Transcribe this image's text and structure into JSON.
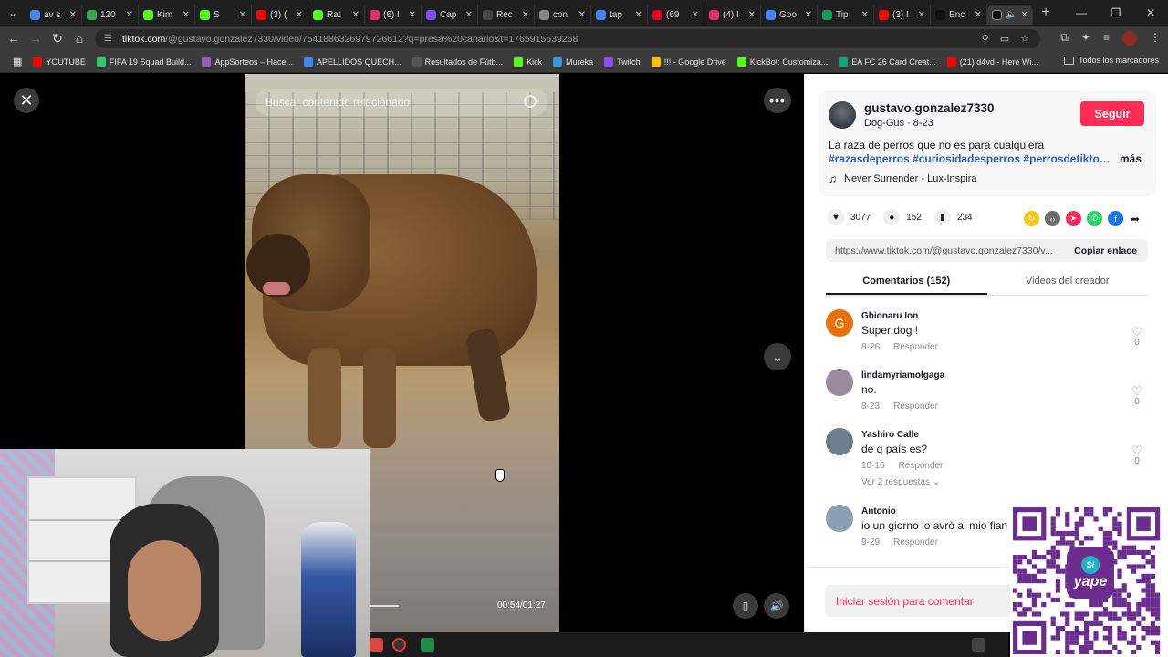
{
  "browser": {
    "tabs": [
      {
        "label": "av s",
        "color": "#4285f4"
      },
      {
        "label": "120",
        "color": "#34a853"
      },
      {
        "label": "Kim",
        "color": "#53fc18"
      },
      {
        "label": "S",
        "color": "#53fc18"
      },
      {
        "label": "(3) (",
        "color": "#ff0000"
      },
      {
        "label": "Rat",
        "color": "#53fc18"
      },
      {
        "label": "(6) I",
        "color": "#e1306c"
      },
      {
        "label": "Cap",
        "color": "#7c4dff"
      },
      {
        "label": "Rec",
        "color": "#444444"
      },
      {
        "label": "con",
        "color": "#888888"
      },
      {
        "label": "tap",
        "color": "#4285f4"
      },
      {
        "label": "(69",
        "color": "#e60023"
      },
      {
        "label": "(4) I",
        "color": "#e1306c"
      },
      {
        "label": "Goo",
        "color": "#4285f4"
      },
      {
        "label": "Tip",
        "color": "#0f9d58"
      },
      {
        "label": "(3) I",
        "color": "#ff0000"
      },
      {
        "label": "Enc",
        "color": "#111111"
      }
    ],
    "url_host": "tiktok.com",
    "url_path": "/@gustavo.gonzalez7330/video/7541886326979726612?q=presa%20canario&t=1765915539268",
    "bookmarks": [
      {
        "label": "YOUTUBE",
        "color": "#ff0000"
      },
      {
        "label": "FIFA 19 Squad Build...",
        "color": "#2ecc71"
      },
      {
        "label": "AppSorteos – Hace...",
        "color": "#9b59b6"
      },
      {
        "label": "APELLIDOS QUECH...",
        "color": "#4285f4"
      },
      {
        "label": "Resultados de Fútb...",
        "color": "#555555"
      },
      {
        "label": "Kick",
        "color": "#53fc18"
      },
      {
        "label": "Mureka",
        "color": "#3498db"
      },
      {
        "label": "Twitch",
        "color": "#9146ff"
      },
      {
        "label": "!!! - Google Drive",
        "color": "#fbbc04"
      },
      {
        "label": "KickBot: Customiza...",
        "color": "#53fc18"
      },
      {
        "label": "EA FC 26 Card Creat...",
        "color": "#16a085"
      },
      {
        "label": "(21) d4vd - Here Wi...",
        "color": "#ff0000"
      }
    ],
    "bookmarks_all": "Todos los marcadores"
  },
  "video": {
    "search_placeholder": "Buscar contenido relacionado",
    "time": "00:54/01:27",
    "progress": 0.62
  },
  "panel": {
    "author": "gustavo.gonzalez7330",
    "author_sub": "Dog-Gus · 8-23",
    "follow": "Seguir",
    "description": "La raza de perros que no es para cualquiera",
    "tags": "#razasdeperros #curiosidadesperros #perrosdetiktok...",
    "more": "más",
    "music": "Never Surrender - Lux-Inspira",
    "likes": "3077",
    "comments_count": "152",
    "saves": "234",
    "share_colors": [
      "#f5c518",
      "#6b6b6b",
      "#fe2c55",
      "#25d366",
      "#1877f2"
    ],
    "link": "https://www.tiktok.com/@gustavo.gonzalez7330/v...",
    "copy_link": "Copiar enlace",
    "tab_comments": "Comentarios (152)",
    "tab_creator": "Videos del creador",
    "login": "Iniciar sesión para comentar"
  },
  "comments": [
    {
      "user": "Ghionaru Ion",
      "text": "Super dog !",
      "date": "8-26",
      "reply": "Responder",
      "likes": "0",
      "avatar_letter": "G",
      "avatar_color": "#e8710a"
    },
    {
      "user": "lindamyriamolgaga",
      "text": "no.",
      "date": "8-23",
      "reply": "Responder",
      "likes": "0",
      "avatar_letter": "",
      "avatar_color": "#9a8b9e"
    },
    {
      "user": "Yashiro Calle",
      "text": "de q país es?",
      "date": "10-16",
      "reply": "Responder",
      "likes": "0",
      "avatar_letter": "",
      "avatar_color": "#6e7f8e",
      "replies": "Ver 2 respuestas"
    },
    {
      "user": "Antonio",
      "text": "io un giorno lo avrò al mio fian",
      "date": "9-29",
      "reply": "Responder",
      "likes": "",
      "avatar_letter": "",
      "avatar_color": "#8aa1b5"
    }
  ],
  "qr": {
    "badge_symbol": "S/",
    "badge_text": "yape",
    "color": "#6b2e8f"
  }
}
